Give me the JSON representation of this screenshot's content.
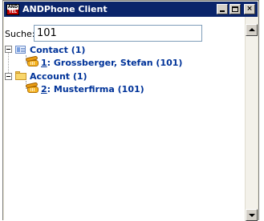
{
  "window": {
    "title": "ANDPhone Client",
    "app_icon_top": "AND",
    "app_icon_bottom": "TEL",
    "minimize_label": "_",
    "close_label": "×"
  },
  "search": {
    "label": "Suche:",
    "value": "101"
  },
  "tree": {
    "groups": [
      {
        "label": "Contact (1)",
        "icon": "contact-card-icon",
        "expanded": true,
        "items": [
          {
            "number": "1",
            "text": ": Grossberger, Stefan (101)",
            "icon": "phone-icon"
          }
        ]
      },
      {
        "label": "Account (1)",
        "icon": "folder-icon",
        "expanded": true,
        "items": [
          {
            "number": "2",
            "text": ": Musterfirma (101)",
            "icon": "phone-icon"
          }
        ]
      }
    ]
  },
  "colors": {
    "titlebar": "#0a246a",
    "link_text": "#003399",
    "window_bg": "#ece9d8"
  }
}
